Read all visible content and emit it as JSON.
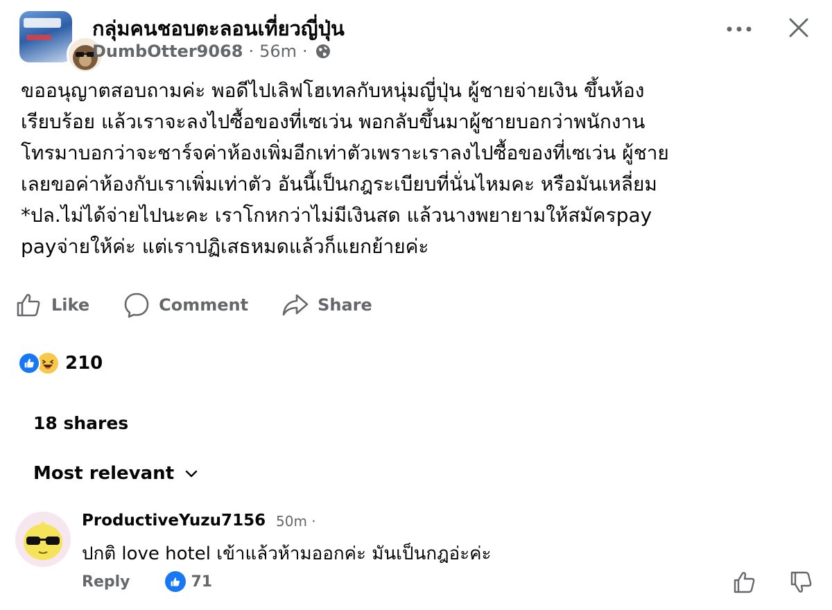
{
  "post": {
    "group_name": "กลุ่มคนชอบตะลอนเที่ยวญี่ปุ่น",
    "author": "DumbOtter9068",
    "time": "56m",
    "dot": "·",
    "lines": [
      "ขออนุญาตสอบถามค่ะ พอดีไปเลิฟโฮเทลกับหนุ่มญี่ปุ่น ผู้ชายจ่ายเงิน ขึ้นห้อง",
      "เรียบร้อย แล้วเราจะลงไปซื้อของที่เซเว่น พอกลับขึ้นมาผู้ชายบอกว่าพนักงาน",
      "โทรมาบอกว่าจะชาร์จค่าห้องเพิ่มอีกเท่าตัวเพราะเราลงไปซื้อของที่เซเว่น ผู้ชาย",
      "เลยขอค่าห้องกับเราเพิ่มเท่าตัว อันนี้เป็นกฎระเบียบที่นั่นไหมคะ หรือมันเหลี่ยม",
      "*ปล.ไม่ได้จ่ายไปนะคะ เราโกหกว่าไม่มีเงินสด แล้วนางพยายามให้สมัครpay",
      "payจ่ายให้ค่ะ แต่เราปฏิเสธหมดแล้วก็แยกย้ายค่ะ"
    ]
  },
  "actions": {
    "like": "Like",
    "comment": "Comment",
    "share": "Share"
  },
  "reactions": {
    "count": "210"
  },
  "shares_text": "18 shares",
  "sort_label": "Most relevant",
  "comment": {
    "author": "ProductiveYuzu7156",
    "time": "50m ·",
    "text": "ปกติ love hotel เข้าแล้วห้ามออกค่ะ มันเป็นกฎอ่ะค่ะ",
    "reply": "Reply",
    "likes": "71"
  },
  "colors": {
    "text": "#050505",
    "secondary": "#65676b",
    "like_blue": "#1877f2",
    "haha_yellow": "#f7c94b"
  }
}
